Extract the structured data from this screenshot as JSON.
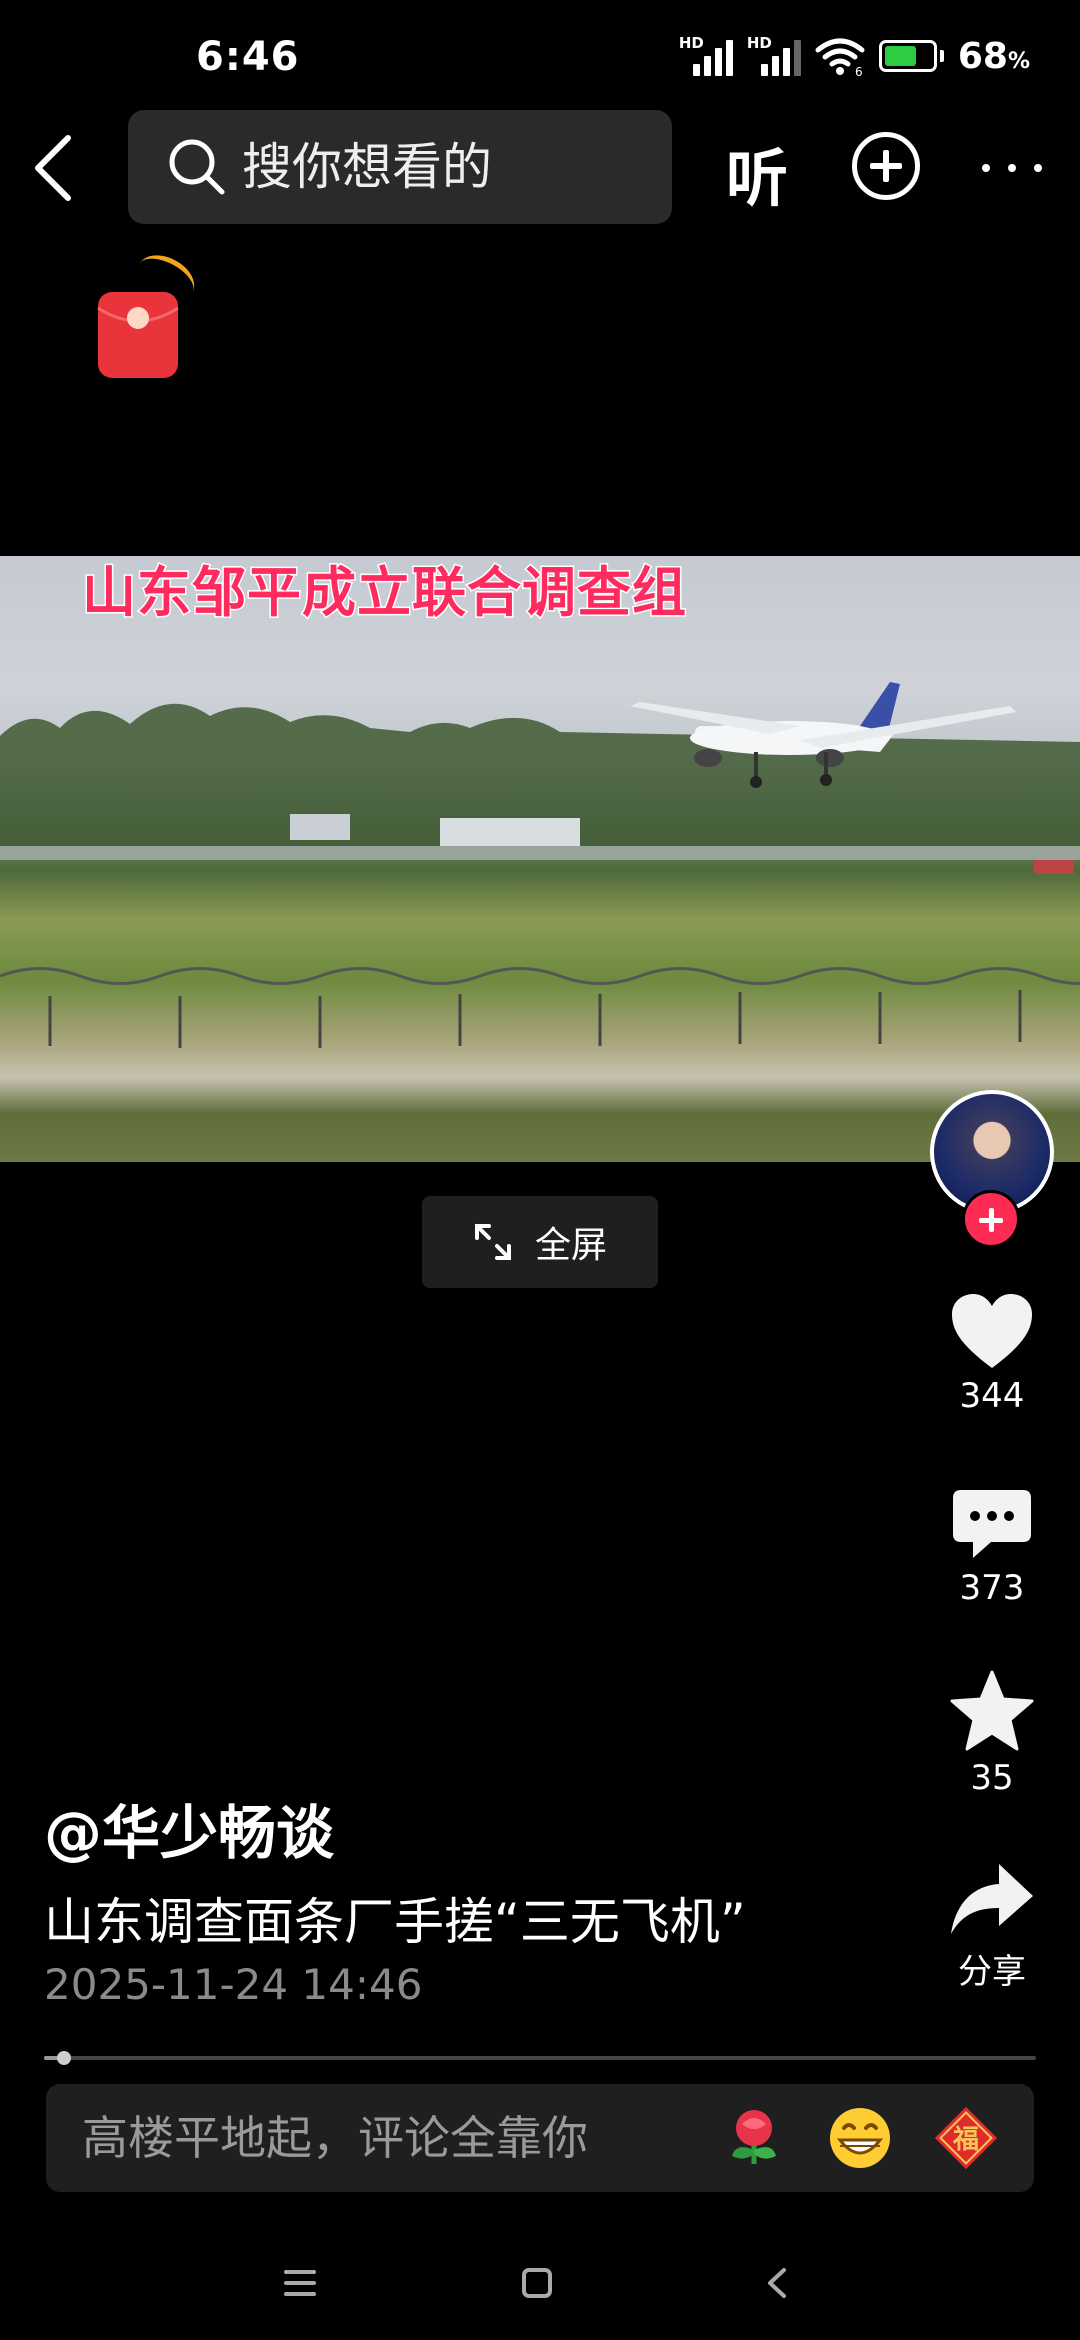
{
  "status_bar": {
    "time": "6:46",
    "signal_1_label": "HD",
    "signal_2_label": "HD",
    "signal_2_sub": "6",
    "battery_percent": 68,
    "battery_text": "68",
    "battery_unit": "%",
    "icons": [
      "signal-icon",
      "wifi-icon",
      "battery-icon"
    ]
  },
  "header": {
    "back_icon": "back-arrow-icon",
    "search_placeholder": "搜你想看的",
    "listen_label": "听",
    "add_icon": "plus-circle-icon",
    "more_icon": "more-dots-icon"
  },
  "video": {
    "caption": "山东邹平成立联合调查组",
    "fullscreen_label": "全屏",
    "progress": 0.02
  },
  "sidebar": {
    "like_count": "344",
    "comment_count": "373",
    "favorite_count": "35",
    "share_label": "分享"
  },
  "post": {
    "author": "@华少畅谈",
    "description": "山东调查面条厂手搓“三无飞机”",
    "date": "2025-11-24 14:46"
  },
  "comment": {
    "placeholder": "高楼平地起，评论全靠你",
    "emoji": [
      "rose-emoji",
      "grin-emoji",
      "fu-emoji"
    ]
  },
  "colors": {
    "accent": "#fe2c55",
    "caption": "#ff2b5e",
    "battery": "#2ecc40",
    "red_packet": "#e8343a"
  }
}
